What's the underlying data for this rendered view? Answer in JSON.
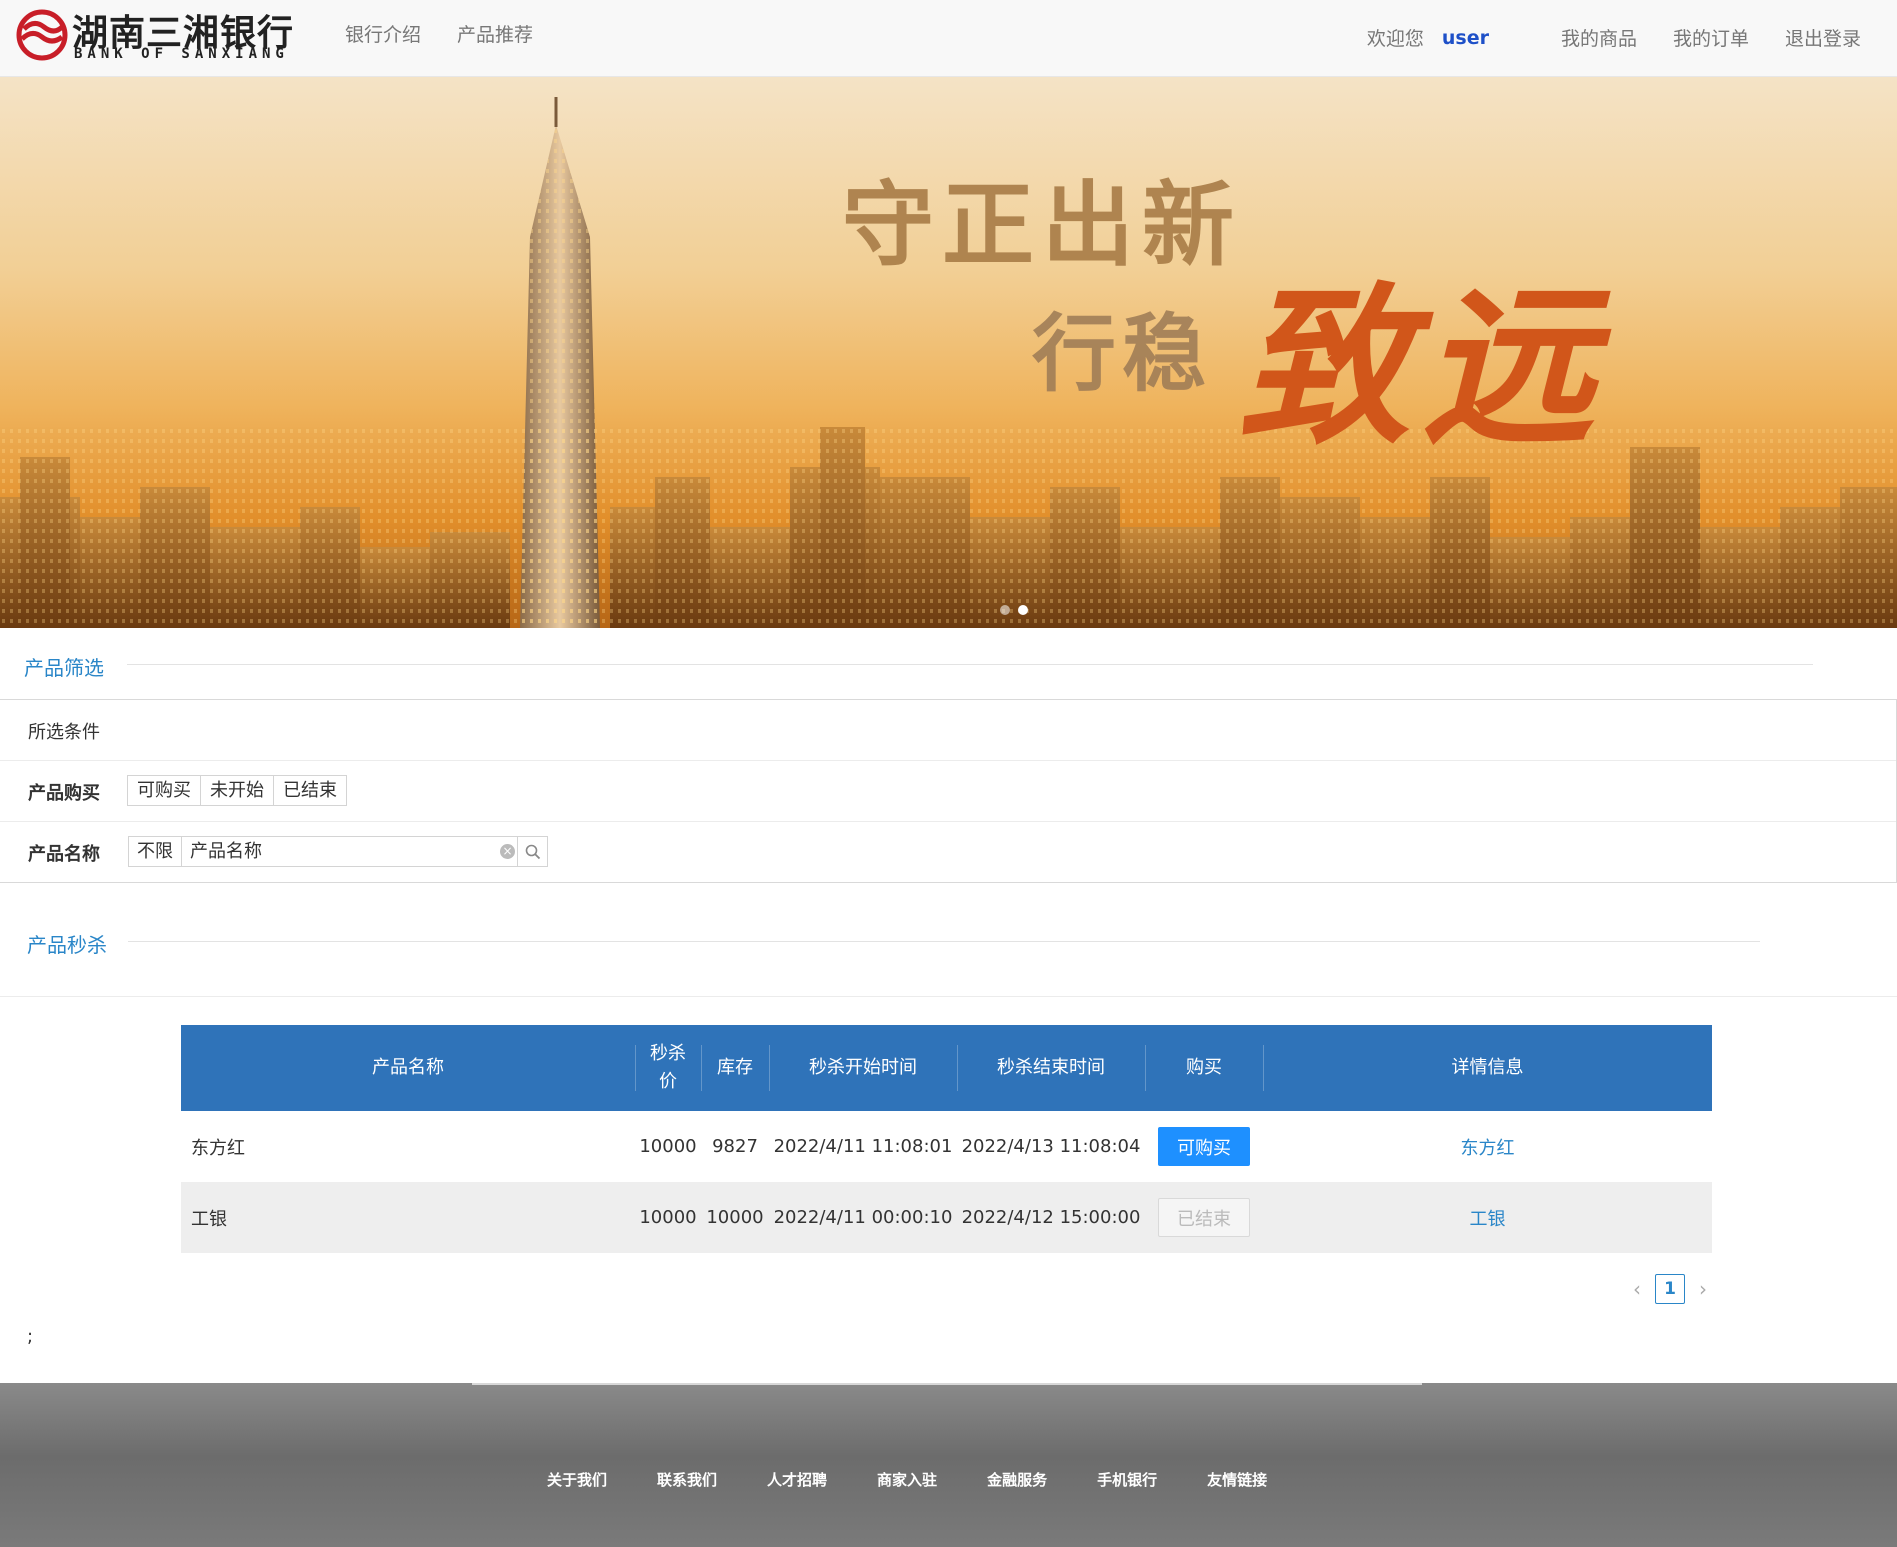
{
  "header": {
    "logo_cn": "湖南三湘银行",
    "logo_en": "BANK OF SANXIANG",
    "nav_left": [
      "银行介绍",
      "产品推荐"
    ],
    "welcome": "欢迎您",
    "username": "user",
    "nav_right": [
      "我的商品",
      "我的订单",
      "退出登录"
    ]
  },
  "banner": {
    "line1": "守正出新",
    "line2": "行稳",
    "line3": "致远"
  },
  "filter_section": {
    "title": "产品筛选",
    "selected_label": "所选条件",
    "purchase_label": "产品购买",
    "purchase_options": [
      "可购买",
      "未开始",
      "已结束"
    ],
    "name_label": "产品名称",
    "name_scope": "不限",
    "name_placeholder": "产品名称"
  },
  "seckill_section": {
    "title": "产品秒杀"
  },
  "table": {
    "headers": [
      "产品名称",
      "秒杀价",
      "库存",
      "秒杀开始时间",
      "秒杀结束时间",
      "购买",
      "详情信息"
    ],
    "rows": [
      {
        "name": "东方红",
        "price": "10000",
        "stock": "9827",
        "start": "2022/4/11 11:08:01",
        "end": "2022/4/13 11:08:04",
        "buy": "可购买",
        "detail": "东方红"
      },
      {
        "name": "工银",
        "price": "10000",
        "stock": "10000",
        "start": "2022/4/11 00:00:10",
        "end": "2022/4/12 15:00:00",
        "buy": "已结束",
        "detail": "工银"
      }
    ]
  },
  "pagination": {
    "current": "1",
    "prev": "‹",
    "next": "›"
  },
  "stray_text": ";",
  "footer": {
    "links": [
      "关于我们",
      "联系我们",
      "人才招聘",
      "商家入驻",
      "金融服务",
      "手机银行",
      "友情链接"
    ]
  },
  "colors": {
    "primary_blue": "#2f73b9",
    "link_blue": "#2a86c8",
    "buy_button": "#1e90ff",
    "slogan_red": "#d1561a"
  }
}
